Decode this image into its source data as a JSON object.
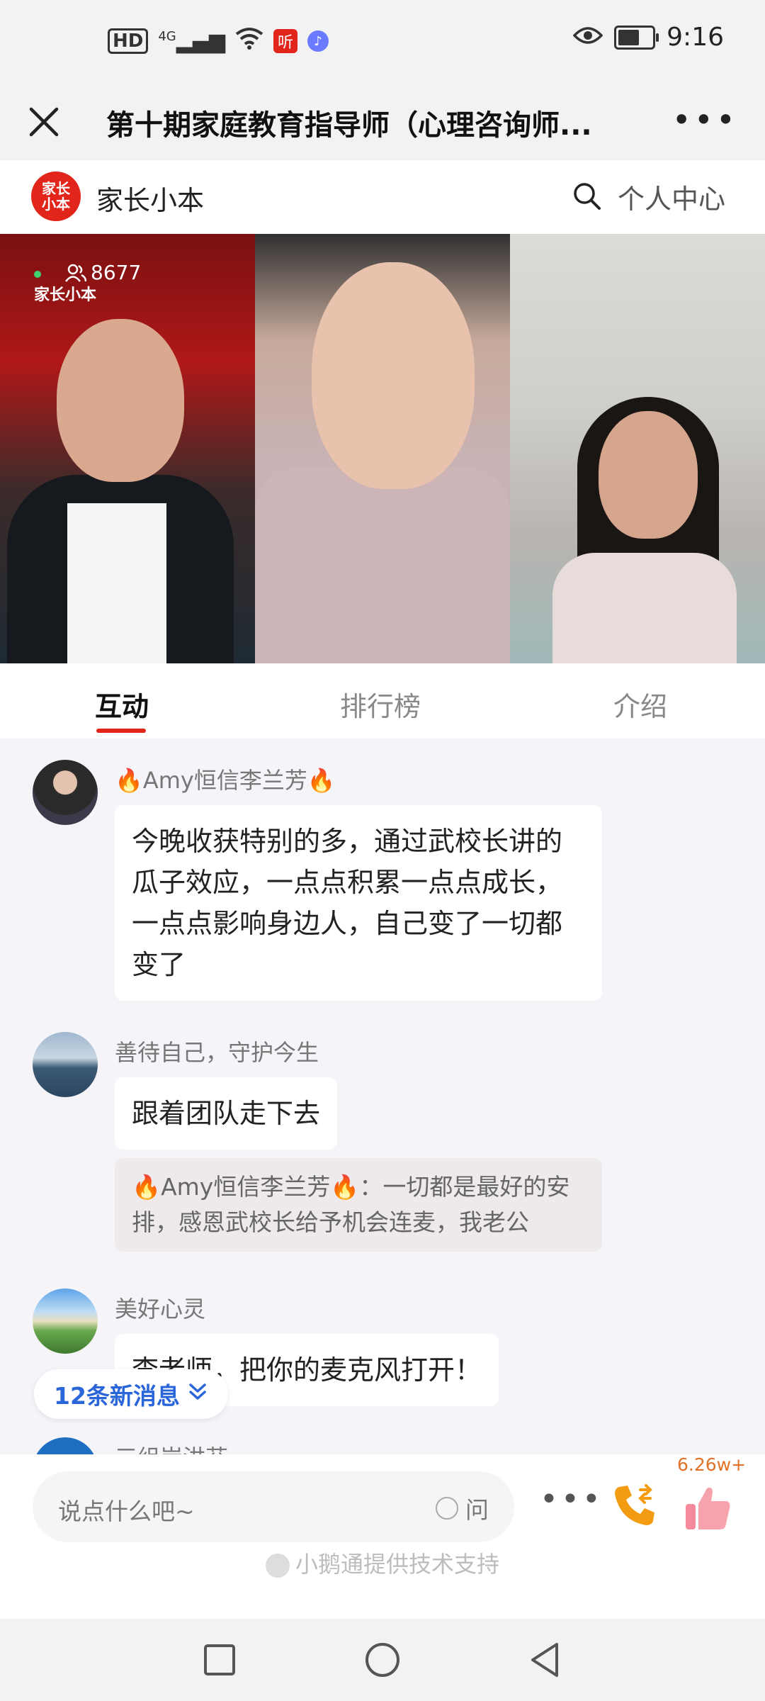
{
  "status_bar": {
    "hd": "HD",
    "network": "4G",
    "app_badge": "听",
    "time": "9:16"
  },
  "title_bar": {
    "title": "第十期家庭教育指导师（心理咨询师..."
  },
  "brand": {
    "logo_text": "家长小本",
    "name": "家长小本",
    "personal_center": "个人中心"
  },
  "video": {
    "viewer_count": "8677",
    "watermark": "家长小本"
  },
  "tabs": [
    {
      "label": "互动",
      "active": true
    },
    {
      "label": "排行榜",
      "active": false
    },
    {
      "label": "介绍",
      "active": false
    }
  ],
  "messages": [
    {
      "user": "🔥Amy恒信李兰芳🔥",
      "text": "今晚收获特别的多，通过武校长讲的瓜子效应，一点点积累一点点成长，一点点影响身边人，自己变了一切都变了"
    },
    {
      "user": "善待自己，守护今生",
      "text": "跟着团队走下去",
      "quote": "🔥Amy恒信李兰芳🔥：一切都是最好的安排，感恩武校长给予机会连麦，我老公"
    },
    {
      "user": "美好心灵",
      "text": "李老师，把你的麦克风打开！"
    },
    {
      "user": "三组岸洪芬"
    }
  ],
  "new_messages": "12条新消息",
  "bottom": {
    "placeholder": "说点什么吧~",
    "ask_label": "问",
    "like_count": "6.26w+",
    "powered_by": "小鹅通提供技术支持"
  },
  "colors": {
    "brand_red": "#e1251b",
    "new_msg_blue": "#2a66d9",
    "like_orange": "#e0722a"
  }
}
